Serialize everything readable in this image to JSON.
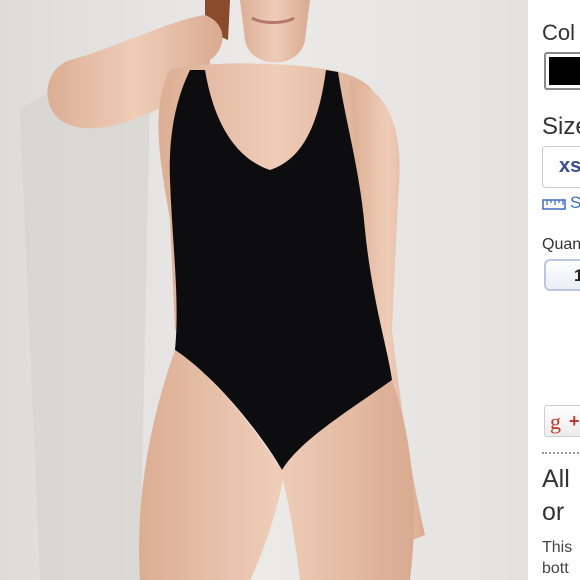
{
  "photo": {
    "alt_subject": "model-wearing-black-bodysuit",
    "colors": {
      "wall": "#e7e6e4",
      "garment": "#0d0d0f",
      "skin": "#e8c3ac",
      "hair": "#8a4a2c"
    }
  },
  "sidebar": {
    "color_label": "Col",
    "selected_color": "#000000",
    "size_label": "Size",
    "size_option": "xs",
    "size_chart_label": "S",
    "quantity_label": "Quan",
    "quantity_value": "1",
    "share_button_text": "g",
    "share_button_plus": "+",
    "heading_line1": "All",
    "heading_line2": "or",
    "description_line1": "This",
    "description_line2": "bott"
  },
  "icons": {
    "ruler": "ruler-icon",
    "gplus": "google-plus-icon"
  }
}
